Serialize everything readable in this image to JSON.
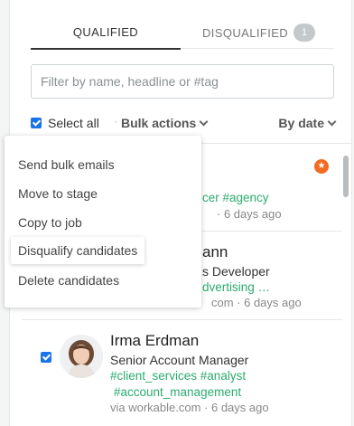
{
  "tabs": {
    "qualified": "QUALIFIED",
    "disqualified": "DISQUALIFIED",
    "disqualified_count": "1"
  },
  "filter": {
    "placeholder": "Filter by name, headline or #tag",
    "value": ""
  },
  "toolbar": {
    "select_all": "Select all",
    "separator": "·",
    "bulk_actions": "Bulk actions",
    "sort": "By date"
  },
  "menu": {
    "items": [
      "Send bulk emails",
      "Move to stage",
      "Copy to job",
      "Disqualify candidates",
      "Delete candidates"
    ]
  },
  "candidates": [
    {
      "name": "",
      "headline": "",
      "tags_line1": "cer #agency",
      "tags_line2": "",
      "meta": "· 6 days ago",
      "starred": true
    },
    {
      "name": "ann",
      "headline": "s Developer",
      "tags_line1": "dvertising …",
      "tags_line2": "",
      "meta": "com · 6 days ago"
    },
    {
      "name": "Irma Erdman",
      "headline": "Senior Account Manager",
      "tags_line1": "#client_services #analyst",
      "tags_line2": "#account_management",
      "meta": "via workable.com · 6 days ago"
    }
  ],
  "colors": {
    "accent": "#1a73e8",
    "tag": "#2bab6f",
    "star": "#f26b21"
  }
}
